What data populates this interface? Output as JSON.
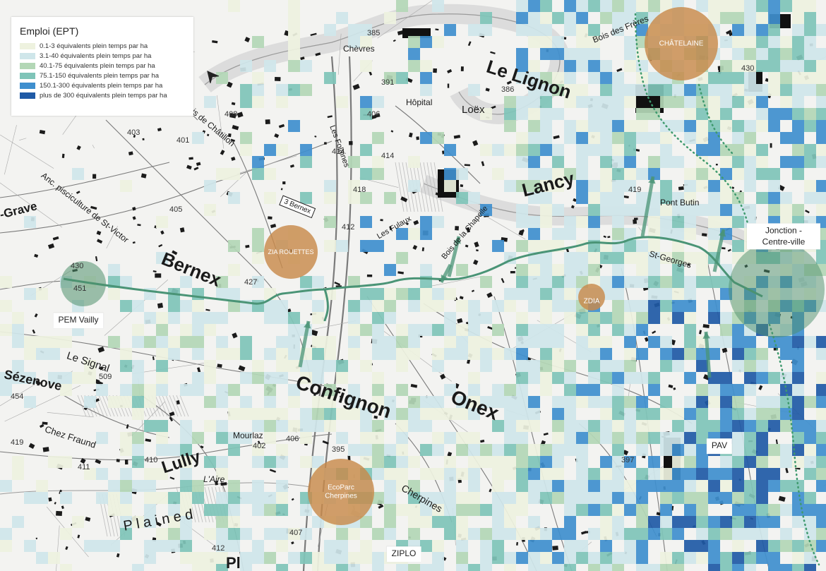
{
  "legend": {
    "title": "Emploi (EPT)",
    "items": [
      {
        "label": "0.1-3 équivalents plein temps par ha",
        "color": "#eef2df"
      },
      {
        "label": "3.1-40 équivalents plein temps par ha",
        "color": "#cfe6ea"
      },
      {
        "label": "40.1-75 équivalents plein temps par ha",
        "color": "#b3d7b6"
      },
      {
        "label": "75.1-150 équivalents plein temps par ha",
        "color": "#7fc4b8"
      },
      {
        "label": "150.1-300 équivalents plein temps par ha",
        "color": "#3f8fce"
      },
      {
        "label": "plus de 300 équivalents plein temps par ha",
        "color": "#1f5aa6"
      }
    ]
  },
  "colors": {
    "route": "#4a9476",
    "site_circle": "#c88a4a",
    "node_circle": "#4e8f6b",
    "dotted_path": "#3f9a6e"
  },
  "sites": [
    {
      "id": "chatelaine",
      "label": "CHÂTELAINE"
    },
    {
      "id": "zia-rouettes",
      "label": "ZIA ROUETTES"
    },
    {
      "id": "zdia",
      "label": "ZDIA"
    },
    {
      "id": "ecoparc",
      "label": "EcoParc Cherpines"
    }
  ],
  "boxes": {
    "pem_vailly": "PEM Vailly",
    "jonction": "Jonction - Centre-ville",
    "pav": "PAV",
    "ziplo": "ZIPLO"
  },
  "places": {
    "le_lignon": "Le Lignon",
    "bernex": "Bernex",
    "confignon": "Confignon",
    "onex": "Onex",
    "lancy": "Lancy",
    "lully": "Lully",
    "sezenove": "Sézenove",
    "le_signal": "Le Signal",
    "pont_butin": "Pont Butin",
    "st_georges": "St-Georges",
    "chevres": "Chèvres",
    "loex": "Loëx",
    "hopital": "Hôpital",
    "les_folaines": "Les Folaines",
    "bois_de_chatillon": "Bois de Châtillon",
    "pisciculture": "Anc. pisciculture de St-Victor",
    "bernex_sign": "3 Bernex",
    "bois_des_freres": "Bois des Frères",
    "les_fulaux": "Les Fulaux",
    "bois_de_la_chapelle": "Bois de la Chapelle",
    "chez_fraund": "Chez Fraund",
    "mourlaz": "Mourlaz",
    "l_aire": "L'Aire",
    "cherpines": "Cherpines",
    "plaine": "P l a i n e d",
    "grave": "-Grave",
    "plan_les_ouates": "Pl"
  },
  "elevations": [
    "430",
    "451",
    "408",
    "403",
    "401",
    "405",
    "427",
    "412",
    "414",
    "418",
    "406",
    "391",
    "385",
    "386",
    "414",
    "419",
    "430",
    "509",
    "454",
    "402",
    "406",
    "410",
    "411",
    "419",
    "407",
    "412",
    "395",
    "397"
  ]
}
